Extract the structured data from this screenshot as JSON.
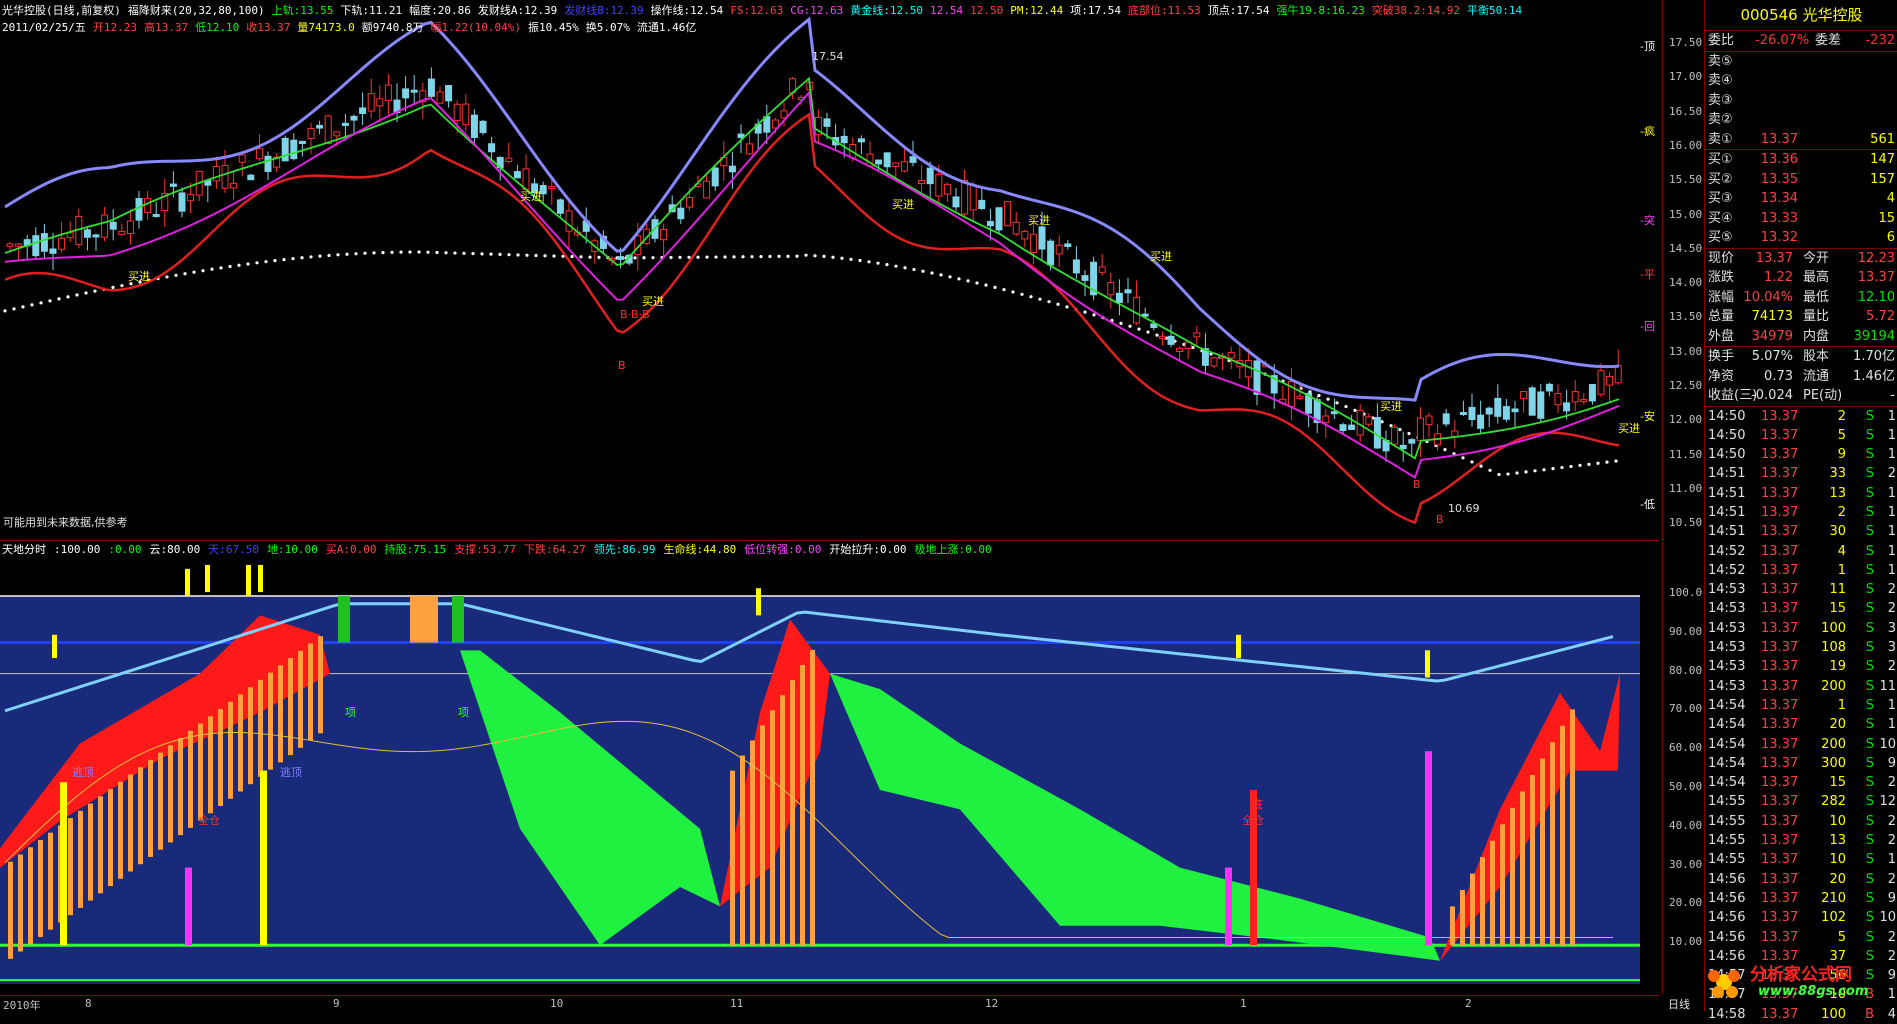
{
  "main_header": {
    "line1": [
      {
        "text": "光华控股(日线,前复权)",
        "color": "#ffffff"
      },
      {
        "text": "福降财来(20,32,80,100)",
        "color": "#ffffff"
      },
      {
        "text": "上轨:13.55",
        "color": "#00ff00"
      },
      {
        "text": "下轨:11.21",
        "color": "#ffffff"
      },
      {
        "text": "幅度:20.86",
        "color": "#ffffff"
      },
      {
        "text": "发财线A:12.39",
        "color": "#ffffff"
      },
      {
        "text": "发财线B:12.39",
        "color": "#4040ff"
      },
      {
        "text": "操作线:12.54",
        "color": "#ffffff"
      },
      {
        "text": "FS:12.63",
        "color": "#ff4040"
      },
      {
        "text": "CG:12.63",
        "color": "#ff40ff"
      },
      {
        "text": "黄金线:12.50",
        "color": "#00ffff"
      },
      {
        "text": "12.54",
        "color": "#ff40ff"
      },
      {
        "text": "12.50",
        "color": "#ff4040"
      },
      {
        "text": "PM:12.44",
        "color": "#ffff00"
      },
      {
        "text": "项:17.54",
        "color": "#ffffff"
      },
      {
        "text": "底部位:11.53",
        "color": "#ff4040"
      },
      {
        "text": "顶点:17.54",
        "color": "#ffffff"
      },
      {
        "text": "强牛19.8:16.23",
        "color": "#00ff00"
      },
      {
        "text": "突破38.2:14.92",
        "color": "#ff4040"
      },
      {
        "text": "平衡50:14",
        "color": "#00ffff"
      }
    ],
    "line2": [
      {
        "text": "2011/02/25/五",
        "color": "#ffffff"
      },
      {
        "text": "开12.23",
        "color": "#ff4040"
      },
      {
        "text": "高13.37",
        "color": "#ff4040"
      },
      {
        "text": "低12.10",
        "color": "#00ff00"
      },
      {
        "text": "收13.37",
        "color": "#ff4040"
      },
      {
        "text": "量74173.0",
        "color": "#ffff00"
      },
      {
        "text": "额9740.8万",
        "color": "#ffffff"
      },
      {
        "text": "幅1.22(10.04%)",
        "color": "#ff4040"
      },
      {
        "text": "振10.45%",
        "color": "#ffffff"
      },
      {
        "text": "换5.07%",
        "color": "#ffffff"
      },
      {
        "text": "流通1.46亿",
        "color": "#ffffff"
      }
    ]
  },
  "main_notice": "可能用到未来数据,供参考",
  "annotations": {
    "buy": "买进",
    "top_price": "17.54",
    "low_price": "10.69",
    "b": "B",
    "bbb": "B·B·B",
    "dingbu": "项",
    "taoding": "逃顶",
    "quancang": "全仓",
    "di": "底"
  },
  "main_axis": [
    "17.50",
    "17.00",
    "16.50",
    "16.00",
    "15.50",
    "15.00",
    "14.50",
    "14.00",
    "13.50",
    "13.00",
    "12.50",
    "12.00",
    "11.50",
    "11.00",
    "10.50"
  ],
  "main_axis_tags": [
    {
      "text": "顶",
      "color": "#ffffff"
    },
    {
      "text": "疯",
      "color": "#ffff00"
    },
    {
      "text": "突",
      "color": "#ff40ff"
    },
    {
      "text": "平",
      "color": "#ff4040"
    },
    {
      "text": "回",
      "color": "#ff40ff"
    },
    {
      "text": "安",
      "color": "#ffff00"
    },
    {
      "text": "低",
      "color": "#ffffff"
    }
  ],
  "sub_header": [
    {
      "text": "天地分时",
      "color": "#ffffff"
    },
    {
      "text": ":100.00",
      "color": "#ffffff"
    },
    {
      "text": ":0.00",
      "color": "#00ff00"
    },
    {
      "text": "云:80.00",
      "color": "#ffffff"
    },
    {
      "text": "天:67.50",
      "color": "#4040ff"
    },
    {
      "text": "地:10.00",
      "color": "#00ff00"
    },
    {
      "text": "买A:0.00",
      "color": "#ff4040"
    },
    {
      "text": "持股:75.15",
      "color": "#00ff00"
    },
    {
      "text": "支撑:53.77",
      "color": "#ff4040"
    },
    {
      "text": "下跌:64.27",
      "color": "#ff4040"
    },
    {
      "text": "领先:86.99",
      "color": "#00ffff"
    },
    {
      "text": "生命线:44.80",
      "color": "#ffff00"
    },
    {
      "text": "低位转强:0.00",
      "color": "#ff40ff"
    },
    {
      "text": "开始拉升:0.00",
      "color": "#ffffff"
    },
    {
      "text": "极地上涨:0.00",
      "color": "#00ff00"
    }
  ],
  "sub_axis": [
    "100.0",
    "90.00",
    "80.00",
    "70.00",
    "60.00",
    "50.00",
    "40.00",
    "30.00",
    "20.00",
    "10.00"
  ],
  "bottom_axis": {
    "labels": [
      "2010年",
      "8",
      "9",
      "10",
      "11",
      "12",
      "1",
      "2"
    ],
    "period": "日线"
  },
  "quote": {
    "code": "000546",
    "name": "光华控股",
    "weibi_label": "委比",
    "weibi": "-26.07%",
    "weicha_label": "委差",
    "weicha": "-232",
    "sells": [
      {
        "label": "卖⑤",
        "price": "",
        "vol": ""
      },
      {
        "label": "卖④",
        "price": "",
        "vol": ""
      },
      {
        "label": "卖③",
        "price": "",
        "vol": ""
      },
      {
        "label": "卖②",
        "price": "",
        "vol": ""
      },
      {
        "label": "卖①",
        "price": "13.37",
        "vol": "561"
      }
    ],
    "buys": [
      {
        "label": "买①",
        "price": "13.36",
        "vol": "147"
      },
      {
        "label": "买②",
        "price": "13.35",
        "vol": "157"
      },
      {
        "label": "买③",
        "price": "13.34",
        "vol": "4"
      },
      {
        "label": "买④",
        "price": "13.33",
        "vol": "15"
      },
      {
        "label": "买⑤",
        "price": "13.32",
        "vol": "6"
      }
    ],
    "stats": [
      {
        "l1": "现价",
        "v1": "13.37",
        "c1": "#ff4040",
        "l2": "今开",
        "v2": "12.23",
        "c2": "#ff4040"
      },
      {
        "l1": "涨跌",
        "v1": "1.22",
        "c1": "#ff4040",
        "l2": "最高",
        "v2": "13.37",
        "c2": "#ff4040"
      },
      {
        "l1": "涨幅",
        "v1": "10.04%",
        "c1": "#ff4040",
        "l2": "最低",
        "v2": "12.10",
        "c2": "#00e000"
      },
      {
        "l1": "总量",
        "v1": "74173",
        "c1": "#ffff00",
        "l2": "量比",
        "v2": "5.72",
        "c2": "#ff4040"
      },
      {
        "l1": "外盘",
        "v1": "34979",
        "c1": "#ff4040",
        "l2": "内盘",
        "v2": "39194",
        "c2": "#00e000"
      }
    ],
    "stats2": [
      {
        "l1": "换手",
        "v1": "5.07%",
        "l2": "股本",
        "v2": "1.70亿"
      },
      {
        "l1": "净资",
        "v1": "0.73",
        "l2": "流通",
        "v2": "1.46亿"
      },
      {
        "l1": "收益(三)",
        "v1": "-0.024",
        "l2": "PE(动)",
        "v2": "-"
      }
    ],
    "ticks": [
      {
        "t": "14:50",
        "p": "13.37",
        "v": "2",
        "s": "S",
        "n": "1"
      },
      {
        "t": "14:50",
        "p": "13.37",
        "v": "5",
        "s": "S",
        "n": "1"
      },
      {
        "t": "14:50",
        "p": "13.37",
        "v": "9",
        "s": "S",
        "n": "1"
      },
      {
        "t": "14:51",
        "p": "13.37",
        "v": "33",
        "s": "S",
        "n": "2"
      },
      {
        "t": "14:51",
        "p": "13.37",
        "v": "13",
        "s": "S",
        "n": "1"
      },
      {
        "t": "14:51",
        "p": "13.37",
        "v": "2",
        "s": "S",
        "n": "1"
      },
      {
        "t": "14:51",
        "p": "13.37",
        "v": "30",
        "s": "S",
        "n": "1"
      },
      {
        "t": "14:52",
        "p": "13.37",
        "v": "4",
        "s": "S",
        "n": "1"
      },
      {
        "t": "14:52",
        "p": "13.37",
        "v": "1",
        "s": "S",
        "n": "1"
      },
      {
        "t": "14:53",
        "p": "13.37",
        "v": "11",
        "s": "S",
        "n": "2"
      },
      {
        "t": "14:53",
        "p": "13.37",
        "v": "15",
        "s": "S",
        "n": "2"
      },
      {
        "t": "14:53",
        "p": "13.37",
        "v": "100",
        "s": "S",
        "n": "3"
      },
      {
        "t": "14:53",
        "p": "13.37",
        "v": "108",
        "s": "S",
        "n": "3"
      },
      {
        "t": "14:53",
        "p": "13.37",
        "v": "19",
        "s": "S",
        "n": "2"
      },
      {
        "t": "14:53",
        "p": "13.37",
        "v": "200",
        "s": "S",
        "n": "11"
      },
      {
        "t": "14:54",
        "p": "13.37",
        "v": "1",
        "s": "S",
        "n": "1"
      },
      {
        "t": "14:54",
        "p": "13.37",
        "v": "20",
        "s": "S",
        "n": "1"
      },
      {
        "t": "14:54",
        "p": "13.37",
        "v": "200",
        "s": "S",
        "n": "10"
      },
      {
        "t": "14:54",
        "p": "13.37",
        "v": "300",
        "s": "S",
        "n": "9"
      },
      {
        "t": "14:54",
        "p": "13.37",
        "v": "15",
        "s": "S",
        "n": "2"
      },
      {
        "t": "14:55",
        "p": "13.37",
        "v": "282",
        "s": "S",
        "n": "12"
      },
      {
        "t": "14:55",
        "p": "13.37",
        "v": "10",
        "s": "S",
        "n": "2"
      },
      {
        "t": "14:55",
        "p": "13.37",
        "v": "13",
        "s": "S",
        "n": "2"
      },
      {
        "t": "14:55",
        "p": "13.37",
        "v": "10",
        "s": "S",
        "n": "1"
      },
      {
        "t": "14:56",
        "p": "13.37",
        "v": "20",
        "s": "S",
        "n": "2"
      },
      {
        "t": "14:56",
        "p": "13.37",
        "v": "210",
        "s": "S",
        "n": "9"
      },
      {
        "t": "14:56",
        "p": "13.37",
        "v": "102",
        "s": "S",
        "n": "10"
      },
      {
        "t": "14:56",
        "p": "13.37",
        "v": "5",
        "s": "S",
        "n": "2"
      },
      {
        "t": "14:56",
        "p": "13.37",
        "v": "37",
        "s": "S",
        "n": "2"
      },
      {
        "t": "14:57",
        "p": "13.37",
        "v": "56",
        "s": "S",
        "n": "9"
      },
      {
        "t": "14:57",
        "p": "13.37",
        "v": "10",
        "s": "B",
        "n": "1"
      },
      {
        "t": "14:58",
        "p": "13.37",
        "v": "100",
        "s": "B",
        "n": "4"
      }
    ]
  },
  "watermark": {
    "line1": "分析家公式网",
    "line2": "www.88gs.com"
  }
}
